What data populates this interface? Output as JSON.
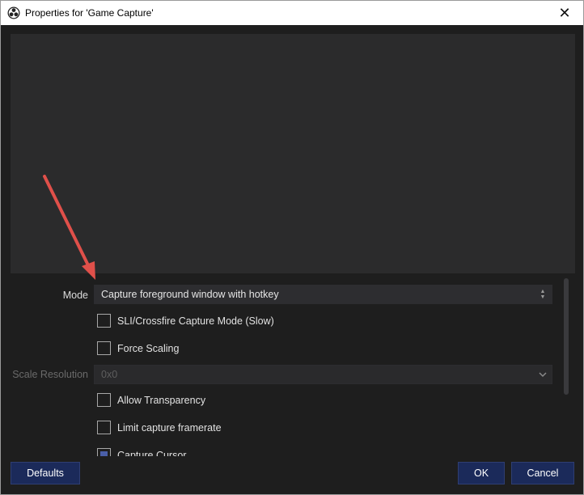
{
  "window": {
    "title": "Properties for 'Game Capture'",
    "close_glyph": "✕"
  },
  "icons": {
    "app": "obs-logo-icon",
    "close": "close-icon",
    "spinner": "updown-arrows-icon",
    "dropdown": "chevron-down-icon",
    "annotation": "red-arrow-annotation"
  },
  "properties": {
    "mode": {
      "label": "Mode",
      "value": "Capture foreground window with hotkey"
    },
    "sli_crossfire": {
      "label": "SLI/Crossfire Capture Mode (Slow)",
      "checked": false
    },
    "force_scaling": {
      "label": "Force Scaling",
      "checked": false
    },
    "scale_resolution": {
      "label": "Scale Resolution",
      "value": "0x0",
      "enabled": false
    },
    "allow_transparency": {
      "label": "Allow Transparency",
      "checked": false
    },
    "limit_framerate": {
      "label": "Limit capture framerate",
      "checked": false
    },
    "capture_cursor": {
      "label": "Capture Cursor",
      "checked": true
    }
  },
  "buttons": {
    "defaults": "Defaults",
    "ok": "OK",
    "cancel": "Cancel"
  },
  "colors": {
    "background": "#1e1e1e",
    "preview": "#2b2b2c",
    "button": "#1b2a5a",
    "annotation": "#e0504a"
  }
}
